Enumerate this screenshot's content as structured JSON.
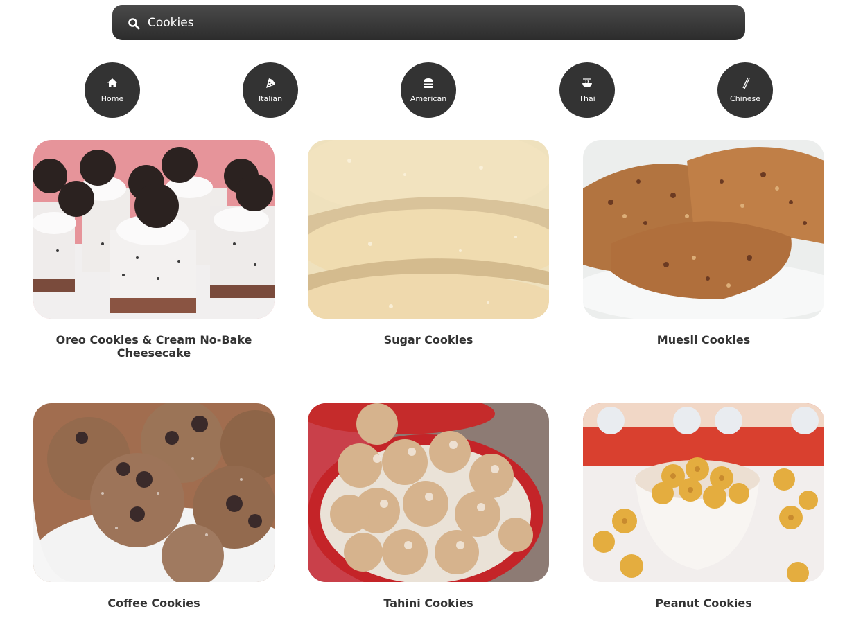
{
  "search": {
    "value": "Cookies"
  },
  "categories": [
    {
      "label": "Home",
      "icon": "home-icon"
    },
    {
      "label": "Italian",
      "icon": "pizza-icon"
    },
    {
      "label": "American",
      "icon": "burger-icon"
    },
    {
      "label": "Thai",
      "icon": "noodle-bowl-icon"
    },
    {
      "label": "Chinese",
      "icon": "chopsticks-icon"
    }
  ],
  "recipes": [
    {
      "title": "Oreo Cookies & Cream No-Bake Cheesecake"
    },
    {
      "title": "Sugar Cookies"
    },
    {
      "title": "Muesli Cookies"
    },
    {
      "title": "Coffee Cookies"
    },
    {
      "title": "Tahini Cookies"
    },
    {
      "title": "Peanut Cookies"
    }
  ],
  "colors": {
    "search_bg": "#3a3a3a",
    "category_bg": "#333333",
    "text": "#333333"
  }
}
